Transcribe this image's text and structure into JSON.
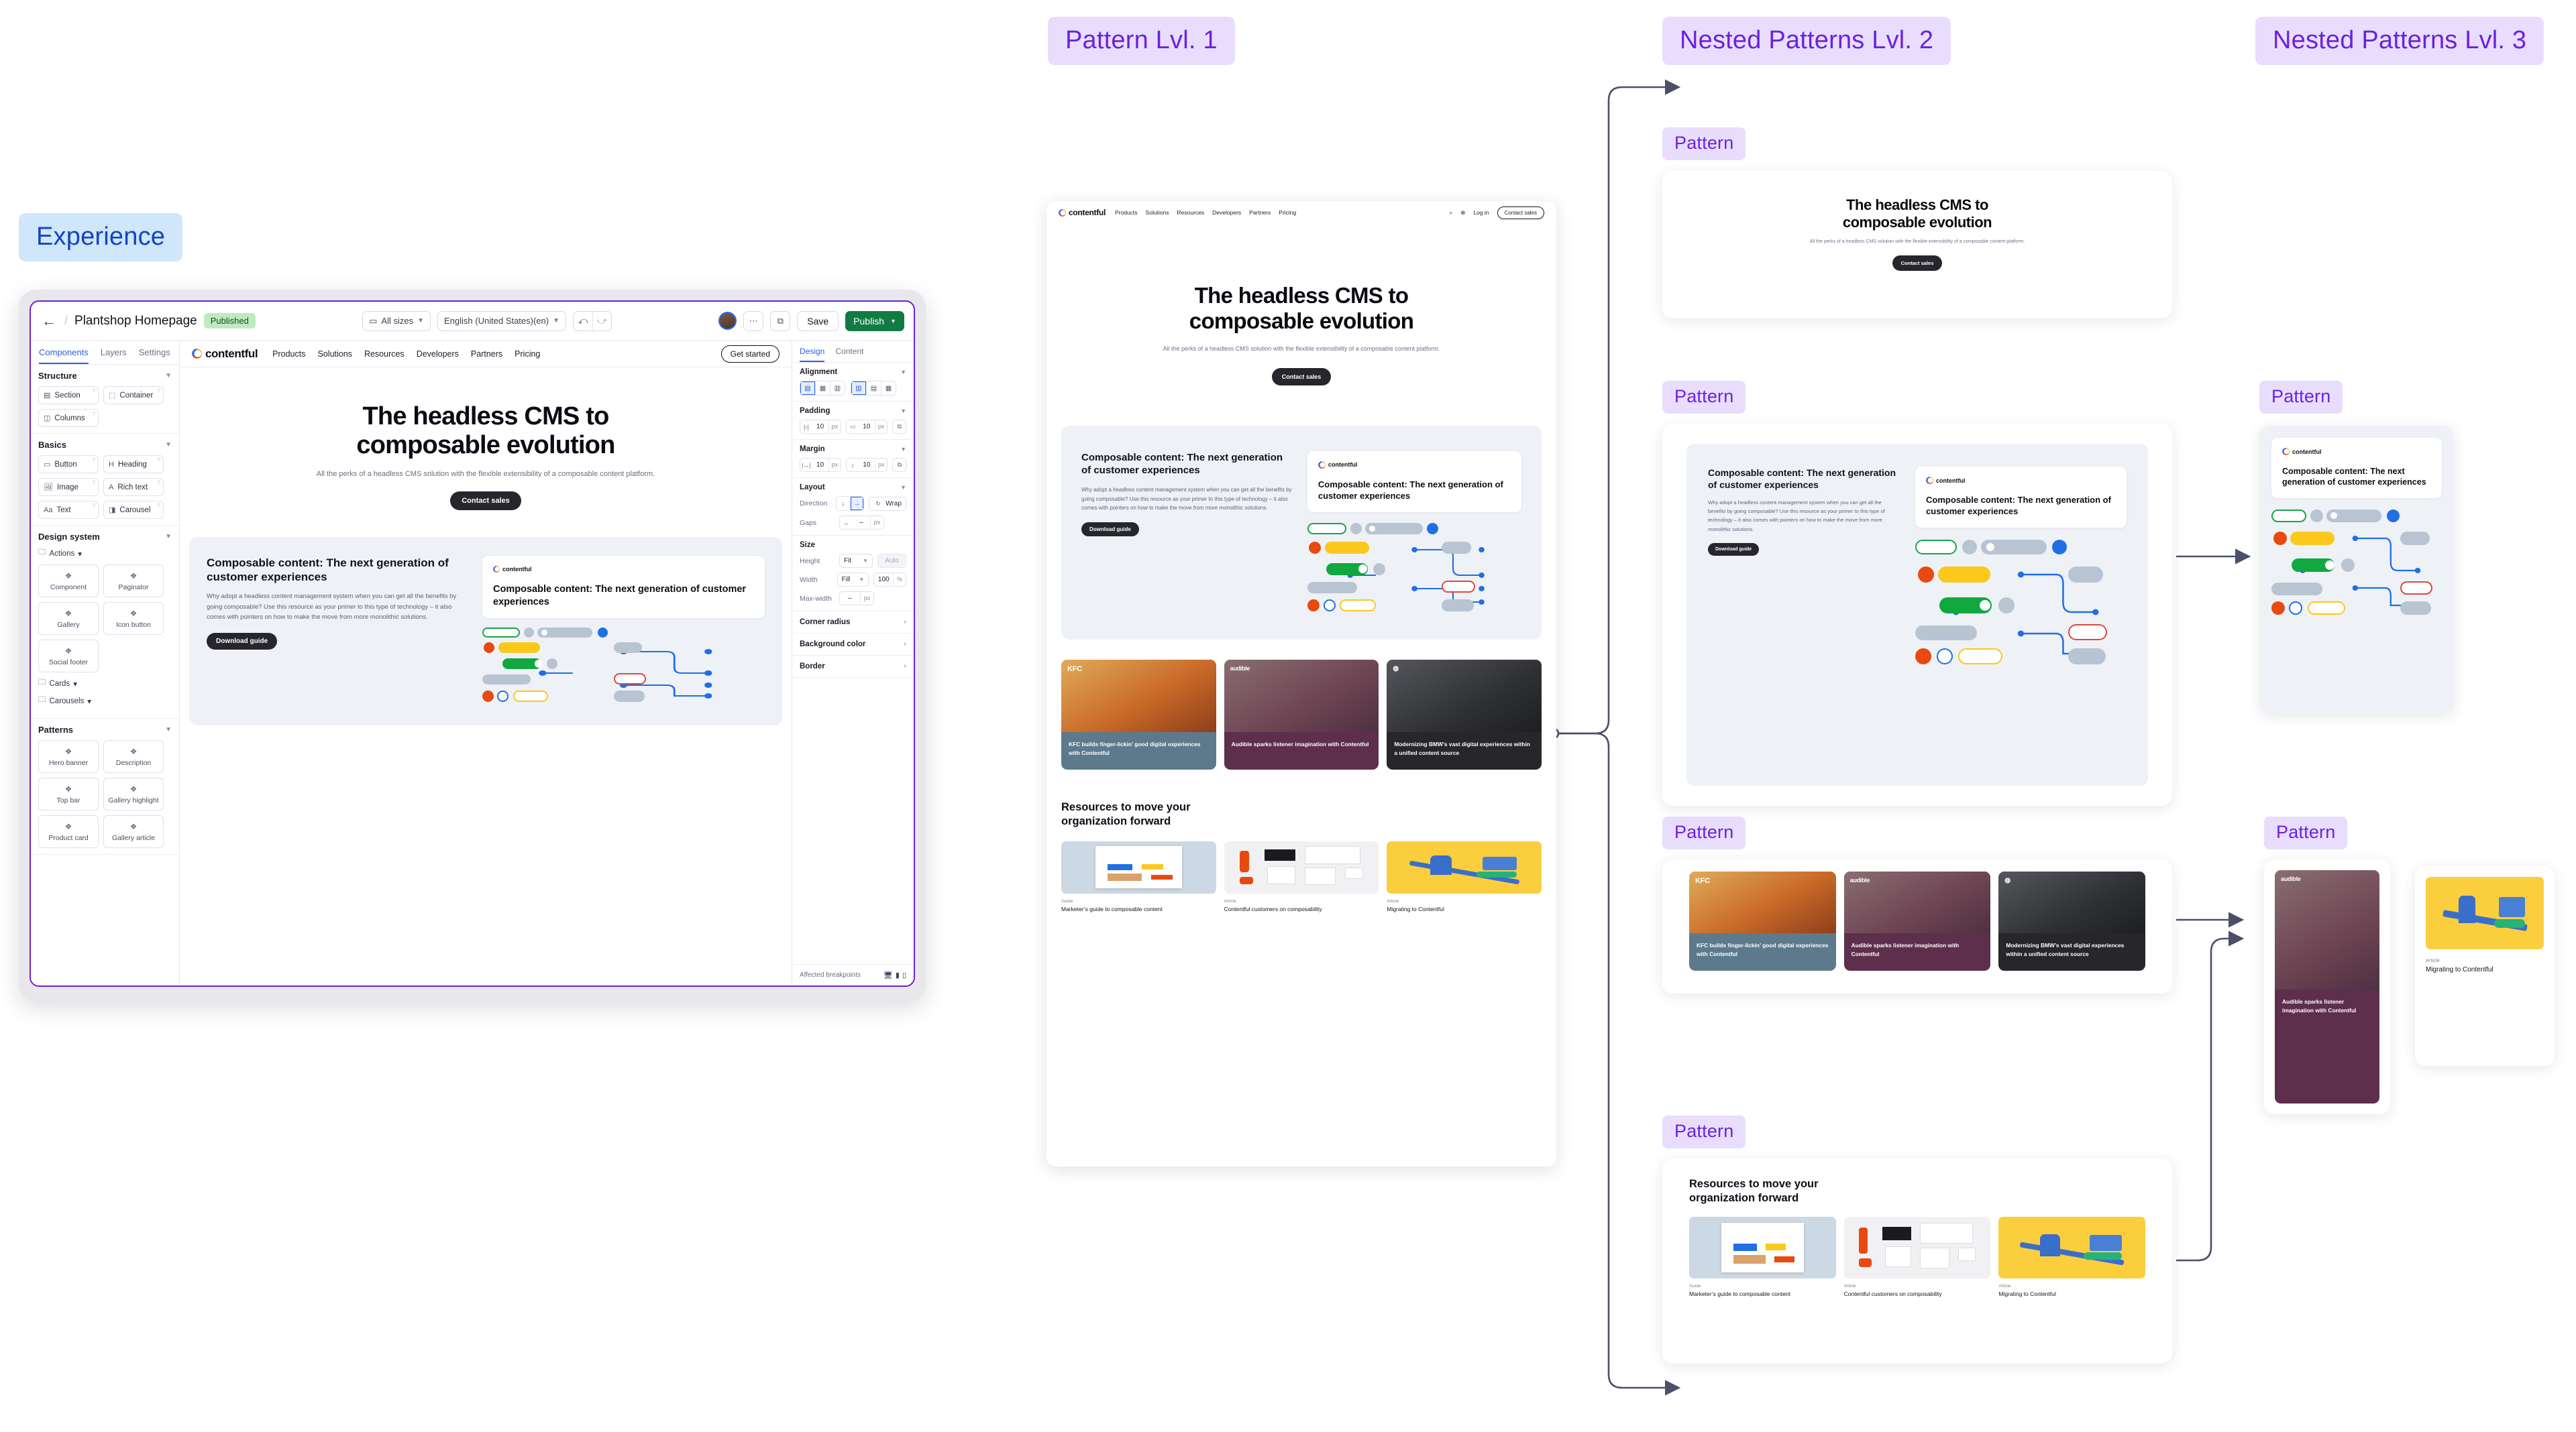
{
  "labels": {
    "experience": "Experience",
    "lvl1": "Pattern  Lvl. 1",
    "lvl2": "Nested Patterns  Lvl. 2",
    "lvl3": "Nested Patterns Lvl. 3",
    "pattern": "Pattern"
  },
  "colors": {
    "experience_bg": "#cfe6fb",
    "experience_fg": "#1344c4",
    "pattern_bg": "#e9ddfd",
    "pattern_fg": "#6a22e0",
    "editor_border": "#6c22d9",
    "publish_green": "#107c41",
    "accent_blue": "#2b5fe0"
  },
  "editor": {
    "back_icon": "arrow-left-icon",
    "separator": "/",
    "title": "Plantshop Homepage",
    "status_badge": "Published",
    "size_select": {
      "icon": "device-icon",
      "value": "All sizes",
      "chevron": "chevron-down-icon"
    },
    "locale_select": {
      "value": "English (United States)(en)",
      "chevron": "chevron-down-icon"
    },
    "undo_icon": "undo-icon",
    "redo_icon": "redo-icon",
    "avatar": "user-avatar",
    "more_icon": "ellipsis-icon",
    "open_icon": "external-link-icon",
    "save_label": "Save",
    "publish_label": "Publish",
    "publish_chevron": "chevron-down-icon",
    "left_tabs": [
      {
        "label": "Components",
        "active": true
      },
      {
        "label": "Layers",
        "active": false
      },
      {
        "label": "Settings",
        "active": false
      }
    ],
    "groups": [
      {
        "title": "Structure",
        "chips": [
          {
            "label": "Section",
            "icon": "section-icon"
          },
          {
            "label": "Container",
            "icon": "container-icon"
          },
          {
            "label": "Columns",
            "icon": "columns-icon"
          }
        ]
      },
      {
        "title": "Basics",
        "chips": [
          {
            "label": "Button",
            "icon": "button-icon"
          },
          {
            "label": "Heading",
            "icon": "heading-icon"
          },
          {
            "label": "Image",
            "icon": "image-icon"
          },
          {
            "label": "Rich text",
            "icon": "richtext-icon"
          },
          {
            "label": "Text",
            "icon": "text-icon"
          },
          {
            "label": "Carousel",
            "icon": "carousel-icon"
          }
        ]
      }
    ],
    "design_system": {
      "title": "Design system",
      "folders": [
        "Actions",
        "Cards",
        "Carousels"
      ],
      "cards": [
        "Component",
        "Paginator",
        "Gallery",
        "Icon button",
        "Social footer"
      ]
    },
    "patterns": {
      "title": "Patterns",
      "cards": [
        "Hero banner",
        "Description",
        "Top bar",
        "Gallery highlight",
        "Product card",
        "Gallery article"
      ]
    },
    "props": {
      "tabs": [
        {
          "label": "Design",
          "active": true
        },
        {
          "label": "Content",
          "active": false
        }
      ],
      "alignment": {
        "title": "Alignment"
      },
      "padding": {
        "title": "Padding",
        "h_value": "10",
        "h_unit": "px",
        "v_value": "10",
        "v_unit": "px"
      },
      "margin": {
        "title": "Margin",
        "h_value": "10",
        "h_unit": "px",
        "v_value": "10",
        "v_unit": "px"
      },
      "layout": {
        "title": "Layout",
        "direction_label": "Direction",
        "wrap_label": "Wrap",
        "gaps_label": "Gaps",
        "gaps_value": "–",
        "gaps_unit": "px"
      },
      "size": {
        "title": "Size",
        "height_label": "Height",
        "height_value": "Fit",
        "height_auto": "Auto",
        "width_label": "Width",
        "width_value": "Fill",
        "width_number": "100",
        "width_unit": "%",
        "maxwidth_label": "Max-width",
        "maxwidth_value": "–",
        "maxwidth_unit": "px"
      },
      "links": [
        "Corner radius",
        "Background color",
        "Border"
      ],
      "footer_label": "Affected breakpoints",
      "breakpoint_icons": [
        "desktop-icon",
        "tablet-icon",
        "mobile-icon"
      ]
    }
  },
  "site": {
    "brand": "contentful",
    "nav_links": [
      "Products",
      "Solutions",
      "Resources",
      "Developers",
      "Partners",
      "Pricing"
    ],
    "nav_cta": "Get started",
    "preview_nav_links": [
      "Products",
      "Solutions",
      "Resources",
      "Developers",
      "Partners",
      "Pricing"
    ],
    "preview_search_icon": "search-icon",
    "preview_login_icon": "login-icon",
    "preview_login": "Log in",
    "preview_cta": "Contact sales",
    "hero": {
      "title_line1": "The headless CMS to",
      "title_line2": "composable evolution",
      "sub": "All the perks of a headless CMS solution with the flexible extensibility of a composable content platform.",
      "cta": "Contact sales"
    },
    "promo": {
      "title": "Composable content: The next generation of customer experiences",
      "body": "Why adopt a headless content management system when you can get all the benefits by going composable? Use this resource as your primer to this type of technology – it also comes with pointers on how to make the move from more monolithic solutions.",
      "cta": "Download guide",
      "card_brand": "contentful",
      "card_title": "Composable content: The next generation of customer experiences"
    },
    "customers": [
      {
        "brand": "KFC",
        "caption": "KFC builds finger-lickin’ good digital experiences with Contentful",
        "bg": "#5d7a8c"
      },
      {
        "brand": "audible",
        "caption": "Audible sparks listener imagination with Contentful",
        "bg": "#5d2f4c"
      },
      {
        "brand": "BMW",
        "caption": "Modernizing BMW’s vast digital experiences within a unified content source",
        "bg": "#26262b"
      }
    ],
    "resources": {
      "heading_line1": "Resources to move your",
      "heading_line2": "organization forward",
      "items": [
        {
          "kind": "Guide",
          "title": "Marketer’s guide to composable content",
          "bg": "#ccd8e4"
        },
        {
          "kind": "Article",
          "title": "Contentful customers on composability",
          "bg": "#f1f1f3"
        },
        {
          "kind": "Article",
          "title": "Migrating to Contentful",
          "bg": "#fbce3e"
        }
      ]
    }
  }
}
